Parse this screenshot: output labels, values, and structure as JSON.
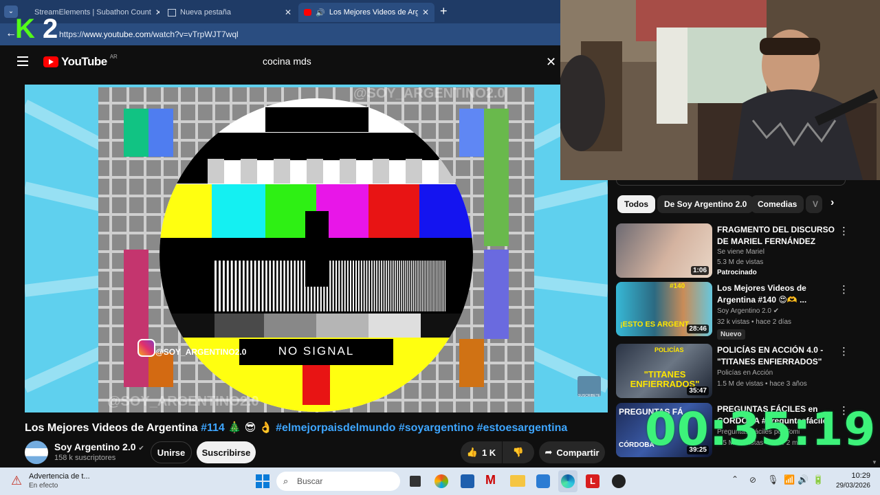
{
  "browser": {
    "tabs": [
      {
        "label": "StreamElements | Subathon Count"
      },
      {
        "label": "Nueva pestaña"
      },
      {
        "label": "Los Mejores Videos de Argentina"
      }
    ],
    "url_prefix": "https://",
    "url_host": "www.youtube.com",
    "url_path": "/watch?v=vTrpWJT7wql",
    "overlay_logo": "K 2"
  },
  "youtube": {
    "logo_text": "YouTube",
    "country": "AR",
    "search_value": "cocina mds",
    "video": {
      "watermark_top": "@SOY_ARGENTINO2.0",
      "watermark_bottom": "@SOY_ARGENTINO2.0",
      "instagram_handle": "@SOY_ARGENTINO2.0",
      "no_signal": "NO SIGNAL",
      "subscribe_badge": "SUSCRIBETE",
      "title_main": "Los Mejores Videos de Argentina",
      "title_tag1": "#114",
      "title_emoji": "🎄 😎 👌",
      "title_tags": "#elmejorpaisdelmundo #soyargentino #estoesargentina"
    },
    "channel": {
      "name": "Soy Argentino 2.0",
      "subs": "158 k suscriptores",
      "join_label": "Unirse",
      "subscribe_label": "Suscribirse",
      "likes": "1 K",
      "share_label": "Compartir"
    },
    "chips": [
      "Todos",
      "De Soy Argentino 2.0",
      "Comedias",
      "V"
    ],
    "recommendations": [
      {
        "title": "FRAGMENTO DEL DISCURSO DE MARIEL FERNÁNDEZ",
        "channel": "Se viene Mariel",
        "meta": "5.3 M de vistas",
        "badge": "Patrocinado",
        "duration": "1:06"
      },
      {
        "title": "Los Mejores Videos de Argentina #140 😍🫶 ...",
        "channel": "Soy Argentino 2.0",
        "meta": "32 k vistas • hace 2 días",
        "badge": "Nuevo",
        "duration": "28:46",
        "thumb_text": "¡ESTO ES ARGENT",
        "thumb_tag": "#140"
      },
      {
        "title": "POLICÍAS EN ACCIÓN 4.0 - \"TITANES ENFIERRADOS\"",
        "channel": "Policías en Acción",
        "meta": "1.5 M de vistas • hace 3 años",
        "badge": "",
        "duration": "35:47",
        "thumb_text": "\"TITANES ENFIERRADOS\"",
        "thumb_tag": "POLICÍAS"
      },
      {
        "title": "PREGUNTAS FÁCILES en CORDOBA #preguntasfáciles",
        "channel": "Preguntas Fáciles por Tomi Luna",
        "meta": "2.5 M de vistas • hace 2 meses",
        "badge": "",
        "duration": "39:25",
        "thumb_text": "CÓRDOBA",
        "thumb_tag": "PREGUNTAS FÁ"
      }
    ]
  },
  "timer": "00:35:19",
  "taskbar": {
    "warning_title": "Advertencia de t...",
    "warning_sub": "En efecto",
    "search_placeholder": "Buscar",
    "time": "10:29",
    "date": "29/03/2026"
  },
  "colors": {
    "accent": "#3ea6ff",
    "timer": "#3df27a",
    "kick": "#53fc18",
    "yt_red": "#ff0000"
  }
}
